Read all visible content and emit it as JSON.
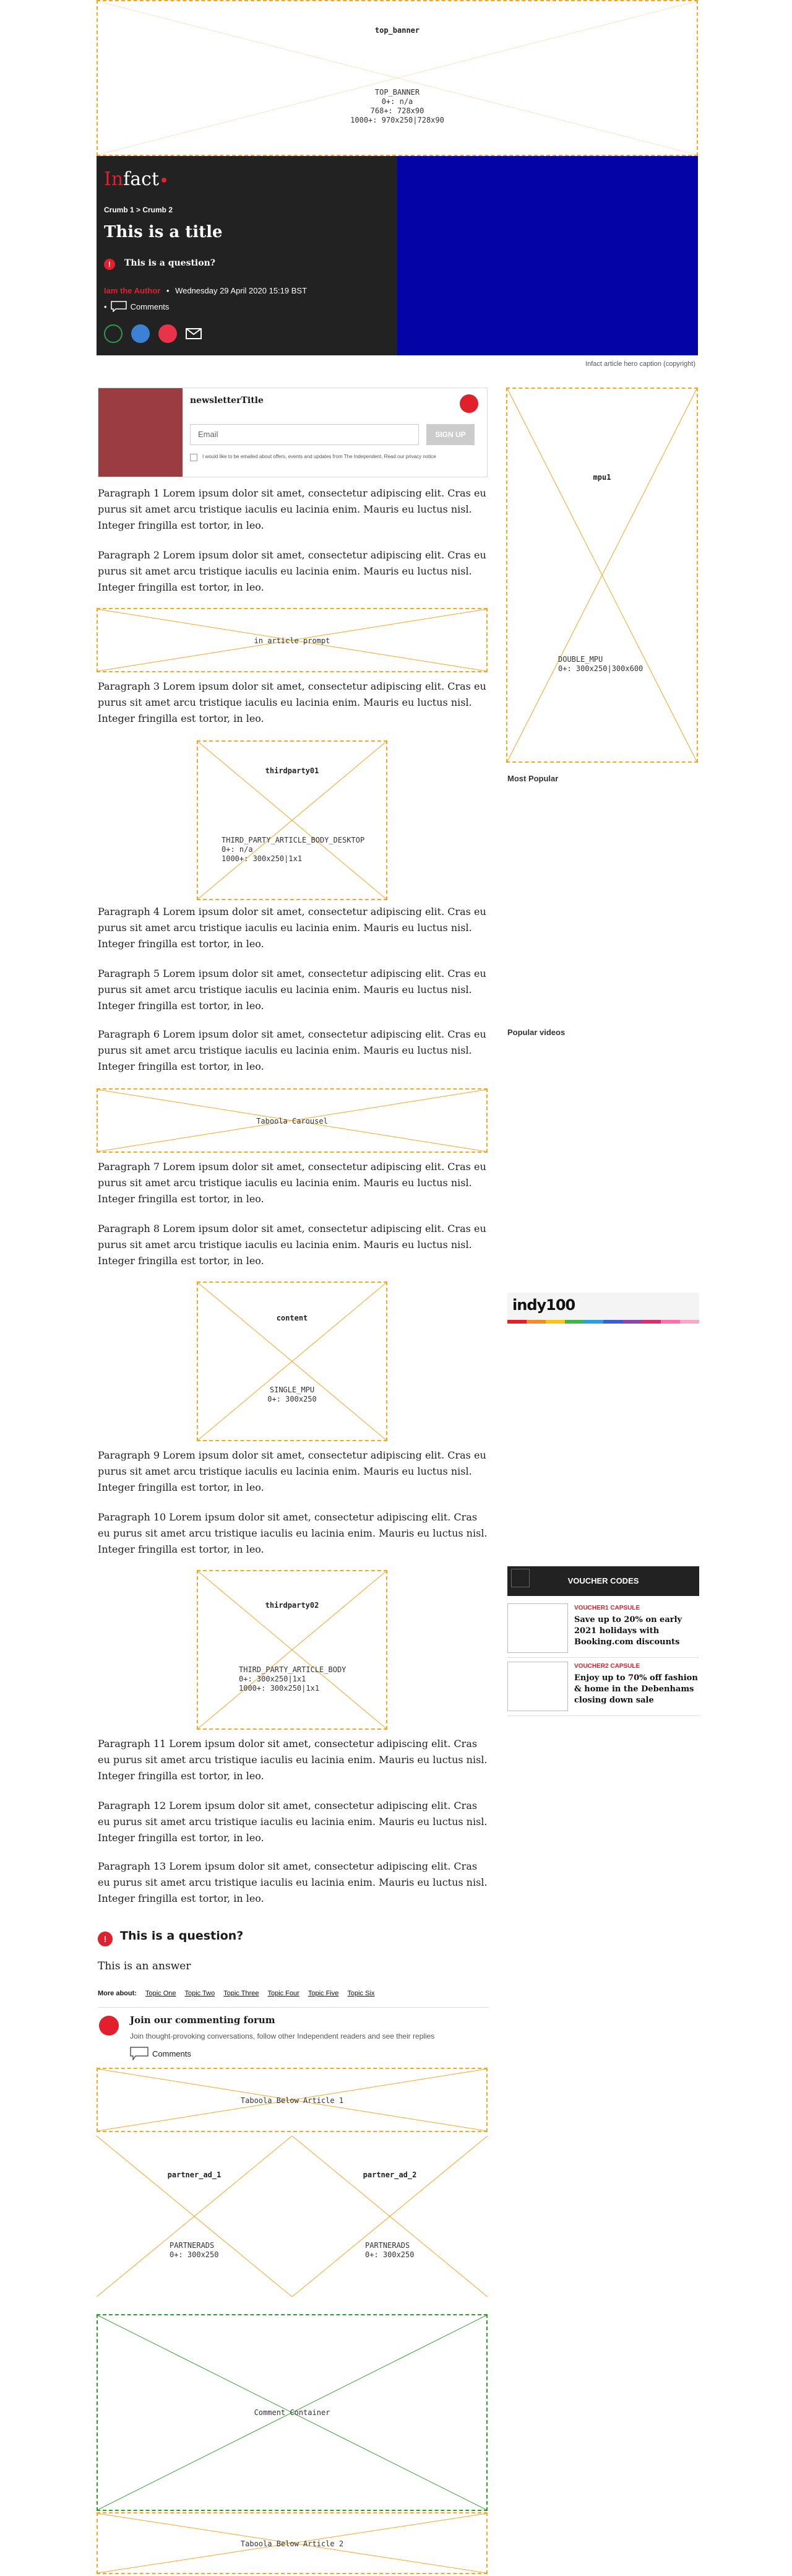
{
  "colors": {
    "accent": "#e0202d",
    "ad_border": "#f5a623",
    "comment_border": "#2a9d2a",
    "hero_dark": "#222222",
    "hero_blue": "#0404a6"
  },
  "ads": {
    "top_banner": {
      "title": "top_banner",
      "info": "TOP_BANNER\n0+: n/a\n768+: 728x90\n1000+: 970x250|728x90"
    },
    "in_article_prompt": {
      "title": "in article prompt"
    },
    "mpu1": {
      "title": "mpu1",
      "info": "DOUBLE_MPU\n0+: 300x250|300x600"
    },
    "thirdparty01": {
      "title": "thirdparty01",
      "info": "THIRD_PARTY_ARTICLE_BODY_DESKTOP\n0+: n/a\n1000+: 300x250|1x1"
    },
    "taboola_carousel": {
      "title": "Taboola Carousel"
    },
    "content": {
      "title": "content",
      "info": "SINGLE_MPU\n0+: 300x250"
    },
    "thirdparty02": {
      "title": "thirdparty02",
      "info": "THIRD_PARTY_ARTICLE_BODY\n0+: 300x250|1x1\n1000+: 300x250|1x1"
    },
    "taboola_below_1": {
      "title": "Taboola Below Article 1"
    },
    "partner_ad_1": {
      "title": "partner_ad_1",
      "info": "PARTNERADS\n0+: 300x250"
    },
    "partner_ad_2": {
      "title": "partner_ad_2",
      "info": "PARTNERADS\n0+: 300x250"
    },
    "comment_container": {
      "title": "Comment Container"
    },
    "taboola_below_2": {
      "title": "Taboola Below Article 2"
    }
  },
  "hero": {
    "logo_in": "In",
    "logo_fact": "fact",
    "breadcrumb": "Crumb 1 > Crumb 2",
    "title": "This is a title",
    "question_badge": "!",
    "question": "This is a question?",
    "author": "Iam the Author",
    "separator": "•",
    "date": "Wednesday 29 April 2020 15:19 BST",
    "comments_bullet": "•",
    "comments_label": "Comments",
    "caption": "Infact article hero caption (copyright)"
  },
  "newsletter": {
    "title": "newsletterTitle",
    "email_placeholder": "Email",
    "button": "SIGN UP",
    "consent": "I would like to be emailed about offers, events and updates from The Independent. Read our privacy notice"
  },
  "paragraphs": [
    "Paragraph 1 Lorem ipsum dolor sit amet, consectetur adipiscing elit. Cras eu purus sit amet arcu tristique iaculis eu lacinia enim. Mauris eu luctus nisl. Integer fringilla est tortor, in leo.",
    "Paragraph 2 Lorem ipsum dolor sit amet, consectetur adipiscing elit. Cras eu purus sit amet arcu tristique iaculis eu lacinia enim. Mauris eu luctus nisl. Integer fringilla est tortor, in leo.",
    "Paragraph 3 Lorem ipsum dolor sit amet, consectetur adipiscing elit. Cras eu purus sit amet arcu tristique iaculis eu lacinia enim. Mauris eu luctus nisl. Integer fringilla est tortor, in leo.",
    "Paragraph 4 Lorem ipsum dolor sit amet, consectetur adipiscing elit. Cras eu purus sit amet arcu tristique iaculis eu lacinia enim. Mauris eu luctus nisl. Integer fringilla est tortor, in leo.",
    "Paragraph 5 Lorem ipsum dolor sit amet, consectetur adipiscing elit. Cras eu purus sit amet arcu tristique iaculis eu lacinia enim. Mauris eu luctus nisl. Integer fringilla est tortor, in leo.",
    "Paragraph 6 Lorem ipsum dolor sit amet, consectetur adipiscing elit. Cras eu purus sit amet arcu tristique iaculis eu lacinia enim. Mauris eu luctus nisl. Integer fringilla est tortor, in leo.",
    "Paragraph 7 Lorem ipsum dolor sit amet, consectetur adipiscing elit. Cras eu purus sit amet arcu tristique iaculis eu lacinia enim. Mauris eu luctus nisl. Integer fringilla est tortor, in leo.",
    "Paragraph 8 Lorem ipsum dolor sit amet, consectetur adipiscing elit. Cras eu purus sit amet arcu tristique iaculis eu lacinia enim. Mauris eu luctus nisl. Integer fringilla est tortor, in leo.",
    "Paragraph 9 Lorem ipsum dolor sit amet, consectetur adipiscing elit. Cras eu purus sit amet arcu tristique iaculis eu lacinia enim. Mauris eu luctus nisl. Integer fringilla est tortor, in leo.",
    "Paragraph 10 Lorem ipsum dolor sit amet, consectetur adipiscing elit. Cras eu purus sit amet arcu tristique iaculis eu lacinia enim. Mauris eu luctus nisl. Integer fringilla est tortor, in leo.",
    "Paragraph 11 Lorem ipsum dolor sit amet, consectetur adipiscing elit. Cras eu purus sit amet arcu tristique iaculis eu lacinia enim. Mauris eu luctus nisl. Integer fringilla est tortor, in leo.",
    "Paragraph 12 Lorem ipsum dolor sit amet, consectetur adipiscing elit. Cras eu purus sit amet arcu tristique iaculis eu lacinia enim. Mauris eu luctus nisl. Integer fringilla est tortor, in leo.",
    "Paragraph 13 Lorem ipsum dolor sit amet, consectetur adipiscing elit. Cras eu purus sit amet arcu tristique iaculis eu lacinia enim. Mauris eu luctus nisl. Integer fringilla est tortor, in leo."
  ],
  "sidebar": {
    "most_popular": "Most Popular",
    "popular_videos": "Popular videos",
    "indy_logo": "indy100",
    "voucher_header": "VOUCHER CODES",
    "vouchers": [
      {
        "category": "VOUCHER1 CAPSULE",
        "title": "Save up to 20% on early 2021 holidays with Booking.com discounts"
      },
      {
        "category": "VOUCHER2 CAPSULE",
        "title": "Enjoy up to 70% off fashion & home in the Debenhams closing down sale"
      }
    ]
  },
  "footer": {
    "question_badge": "!",
    "question": "This is a question?",
    "answer": "This is an answer",
    "more_about_label": "More about:",
    "topics": [
      "Topic One",
      "Topic Two",
      "Topic Three",
      "Topic Four",
      "Topic Five",
      "Topic Six"
    ],
    "forum_title": "Join our commenting forum",
    "forum_sub": "Join thought-provoking conversations, follow other Independent readers and see their replies",
    "comments_label": "Comments"
  }
}
